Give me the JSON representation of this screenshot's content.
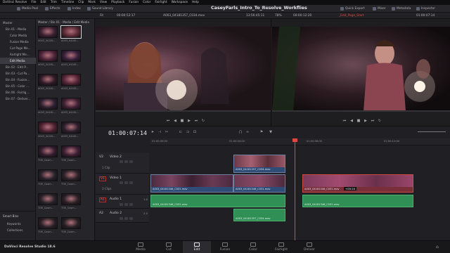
{
  "menubar": {
    "items": [
      "DaVinci Resolve",
      "File",
      "Edit",
      "Trim",
      "Timeline",
      "Clip",
      "Mark",
      "View",
      "Playback",
      "Fusion",
      "Color",
      "Fairlight",
      "Workspace",
      "Help"
    ]
  },
  "toolbar": {
    "media_pool": "Media Pool",
    "effects": "Effects",
    "index": "Index",
    "sound_library": "Sound Library",
    "project_title": "CaseyFarls_Intro_To_Resolve_Workflies",
    "edited": "Edited",
    "quick_export": "Quick Export",
    "mixer": "Mixer",
    "metadata": "Metadata",
    "inspector": "Inspector"
  },
  "source_viewer": {
    "zoom": "Fit",
    "duration": "00:00:52:17",
    "clip_name": "A003_04181357_C034.mov",
    "timecode": "13:56:45:11"
  },
  "timeline_viewer": {
    "zoom": "78%",
    "duration": "00:00:12:20",
    "timeline_name": "_Edit_Page_Start",
    "timecode": "01:00:07:14"
  },
  "bins": {
    "master": "Master",
    "items": [
      "Bin 01 - Media",
      "Color Media",
      "Fusion Media",
      "Cut Page Me...",
      "Fairlight Me...",
      "Edit Media",
      "Bin 02 - Edit P...",
      "Bin 03 - Cut Pa...",
      "Bin 04 - Fusion...",
      "Bin 05 - Color ...",
      "Bin 06 - Fairlig...",
      "Bin 07 - Deliver..."
    ],
    "smart_bins_title": "Smart Bins",
    "smart_items": [
      "Keywords",
      "Collections"
    ]
  },
  "media_pool": {
    "path": "Master / Bin 01 - Media / Edit Media",
    "clips": [
      {
        "label": "A003_04181...",
        "color": "#3a1f30"
      },
      {
        "label": "A003_04181...",
        "color": "#5a2a35"
      },
      {
        "label": "A003_04181...",
        "color": "#4a2238"
      },
      {
        "label": "A003_04181...",
        "color": "#35203a"
      },
      {
        "label": "A003_04181...",
        "color": "#2e1a26"
      },
      {
        "label": "A003_04181...",
        "color": "#552436"
      },
      {
        "label": "A003_04181...",
        "color": "#2a2030"
      },
      {
        "label": "A003_04181...",
        "color": "#3f2034"
      },
      {
        "label": "A003_04181...",
        "color": "#4c2030"
      },
      {
        "label": "A003_04181...",
        "color": "#2c1f2c"
      },
      {
        "label": "TOE_Cosm...",
        "color": "#311c2e"
      },
      {
        "label": "TOE_Cosm...",
        "color": "#3b1e33"
      },
      {
        "label": "TOE_Cosm...",
        "color": "#26222a"
      },
      {
        "label": "TOE_Cosm...",
        "color": "#2b2228"
      },
      {
        "label": "TOE_Cosm...",
        "color": "#272227"
      },
      {
        "label": "TOE_Cosm...",
        "color": "#2a2026"
      },
      {
        "label": "TOE_Cosm...",
        "color": "#282026"
      },
      {
        "label": "TOE_Cosm...",
        "color": "#262024"
      }
    ]
  },
  "timeline": {
    "timecode": "01:00:07:14",
    "ruler": [
      "01:00:00:00",
      "01:00:04:00",
      "01:00:08:00",
      "01:00:12:00"
    ],
    "tracks": {
      "v2": {
        "id": "V2",
        "name": "Video 2",
        "clips": "1 Clip"
      },
      "v1": {
        "id": "V1",
        "name": "Video 1",
        "clips": "3 Clips"
      },
      "a1": {
        "id": "A1",
        "name": "Audio 1",
        "level": "1.0"
      },
      "a2": {
        "id": "A2",
        "name": "Audio 2",
        "level": "2.0"
      }
    },
    "video_clips": {
      "v2_clip": "A003_04181357_C034.mov",
      "v1_clip1": "A003_04181346_C031.mov",
      "v1_clip2": "A003_04181346_C031.mov",
      "v1_clip3": "A003_04181346_C031.mov"
    },
    "audio_clips": {
      "a1_clip1": "A003_04181346_C031.mov",
      "a1_clip2": "A003_04181346_C031.mov",
      "a2_clip": "A003_04181357_C034.mov"
    },
    "trim_badge": "+00:20"
  },
  "pagebar": {
    "app_name": "DaVinci Resolve Studio 18.6",
    "tabs": [
      "Media",
      "Cut",
      "Edit",
      "Fusion",
      "Color",
      "Fairlight",
      "Deliver"
    ],
    "active": "Edit"
  },
  "colors": {
    "accent_red": "#e0483f",
    "video_clip": "#2f4c76",
    "audio_clip": "#2f8f55",
    "playhead": "#e0483f"
  }
}
